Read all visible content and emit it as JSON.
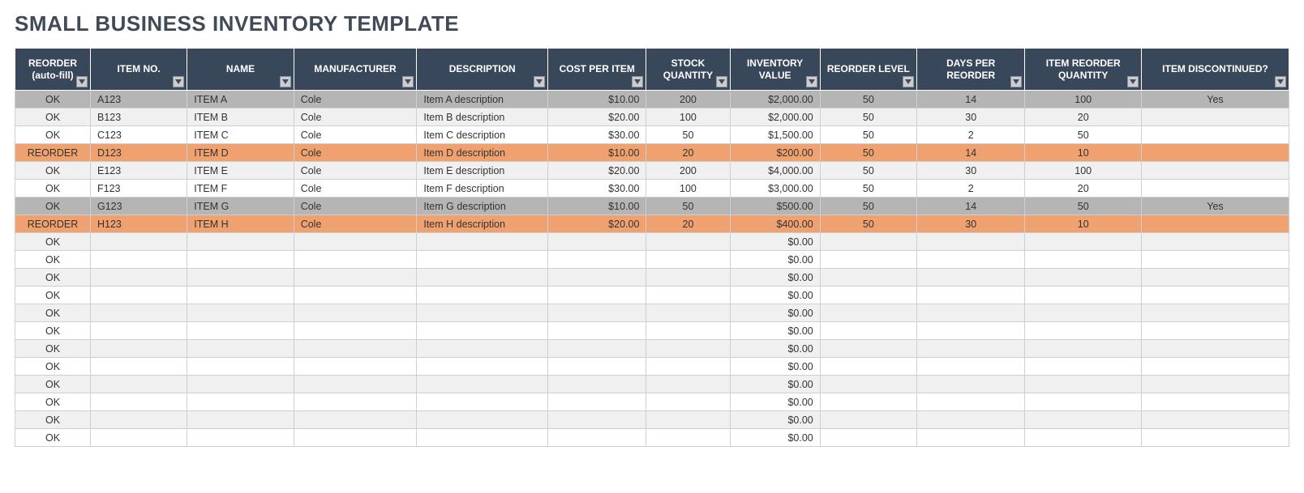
{
  "title": "SMALL BUSINESS INVENTORY TEMPLATE",
  "columns": [
    {
      "label": "REORDER\n(auto-fill)",
      "align": "center"
    },
    {
      "label": "ITEM NO.",
      "align": "left"
    },
    {
      "label": "NAME",
      "align": "left"
    },
    {
      "label": "MANUFACTURER",
      "align": "left"
    },
    {
      "label": "DESCRIPTION",
      "align": "left"
    },
    {
      "label": "COST PER ITEM",
      "align": "right"
    },
    {
      "label": "STOCK QUANTITY",
      "align": "center"
    },
    {
      "label": "INVENTORY VALUE",
      "align": "right"
    },
    {
      "label": "REORDER LEVEL",
      "align": "center"
    },
    {
      "label": "DAYS PER REORDER",
      "align": "center"
    },
    {
      "label": "ITEM REORDER QUANTITY",
      "align": "center"
    },
    {
      "label": "ITEM DISCONTINUED?",
      "align": "center"
    }
  ],
  "rows": [
    {
      "state": "disc",
      "cells": [
        "OK",
        "A123",
        "ITEM A",
        "Cole",
        "Item A description",
        "$10.00",
        "200",
        "$2,000.00",
        "50",
        "14",
        "100",
        "Yes"
      ]
    },
    {
      "state": "plain",
      "cells": [
        "OK",
        "B123",
        "ITEM B",
        "Cole",
        "Item B description",
        "$20.00",
        "100",
        "$2,000.00",
        "50",
        "30",
        "20",
        ""
      ]
    },
    {
      "state": "plain",
      "cells": [
        "OK",
        "C123",
        "ITEM C",
        "Cole",
        "Item C description",
        "$30.00",
        "50",
        "$1,500.00",
        "50",
        "2",
        "50",
        ""
      ]
    },
    {
      "state": "reorder",
      "cells": [
        "REORDER",
        "D123",
        "ITEM D",
        "Cole",
        "Item D description",
        "$10.00",
        "20",
        "$200.00",
        "50",
        "14",
        "10",
        ""
      ]
    },
    {
      "state": "plain",
      "cells": [
        "OK",
        "E123",
        "ITEM E",
        "Cole",
        "Item E description",
        "$20.00",
        "200",
        "$4,000.00",
        "50",
        "30",
        "100",
        ""
      ]
    },
    {
      "state": "plain",
      "cells": [
        "OK",
        "F123",
        "ITEM F",
        "Cole",
        "Item F description",
        "$30.00",
        "100",
        "$3,000.00",
        "50",
        "2",
        "20",
        ""
      ]
    },
    {
      "state": "disc",
      "cells": [
        "OK",
        "G123",
        "ITEM G",
        "Cole",
        "Item G description",
        "$10.00",
        "50",
        "$500.00",
        "50",
        "14",
        "50",
        "Yes"
      ]
    },
    {
      "state": "reorder",
      "cells": [
        "REORDER",
        "H123",
        "ITEM H",
        "Cole",
        "Item H description",
        "$20.00",
        "20",
        "$400.00",
        "50",
        "30",
        "10",
        ""
      ]
    },
    {
      "state": "plain",
      "cells": [
        "OK",
        "",
        "",
        "",
        "",
        "",
        "",
        "$0.00",
        "",
        "",
        "",
        ""
      ]
    },
    {
      "state": "plain",
      "cells": [
        "OK",
        "",
        "",
        "",
        "",
        "",
        "",
        "$0.00",
        "",
        "",
        "",
        ""
      ]
    },
    {
      "state": "plain",
      "cells": [
        "OK",
        "",
        "",
        "",
        "",
        "",
        "",
        "$0.00",
        "",
        "",
        "",
        ""
      ]
    },
    {
      "state": "plain",
      "cells": [
        "OK",
        "",
        "",
        "",
        "",
        "",
        "",
        "$0.00",
        "",
        "",
        "",
        ""
      ]
    },
    {
      "state": "plain",
      "cells": [
        "OK",
        "",
        "",
        "",
        "",
        "",
        "",
        "$0.00",
        "",
        "",
        "",
        ""
      ]
    },
    {
      "state": "plain",
      "cells": [
        "OK",
        "",
        "",
        "",
        "",
        "",
        "",
        "$0.00",
        "",
        "",
        "",
        ""
      ]
    },
    {
      "state": "plain",
      "cells": [
        "OK",
        "",
        "",
        "",
        "",
        "",
        "",
        "$0.00",
        "",
        "",
        "",
        ""
      ]
    },
    {
      "state": "plain",
      "cells": [
        "OK",
        "",
        "",
        "",
        "",
        "",
        "",
        "$0.00",
        "",
        "",
        "",
        ""
      ]
    },
    {
      "state": "plain",
      "cells": [
        "OK",
        "",
        "",
        "",
        "",
        "",
        "",
        "$0.00",
        "",
        "",
        "",
        ""
      ]
    },
    {
      "state": "plain",
      "cells": [
        "OK",
        "",
        "",
        "",
        "",
        "",
        "",
        "$0.00",
        "",
        "",
        "",
        ""
      ]
    },
    {
      "state": "plain",
      "cells": [
        "OK",
        "",
        "",
        "",
        "",
        "",
        "",
        "$0.00",
        "",
        "",
        "",
        ""
      ]
    },
    {
      "state": "plain",
      "cells": [
        "OK",
        "",
        "",
        "",
        "",
        "",
        "",
        "$0.00",
        "",
        "",
        "",
        ""
      ]
    }
  ]
}
